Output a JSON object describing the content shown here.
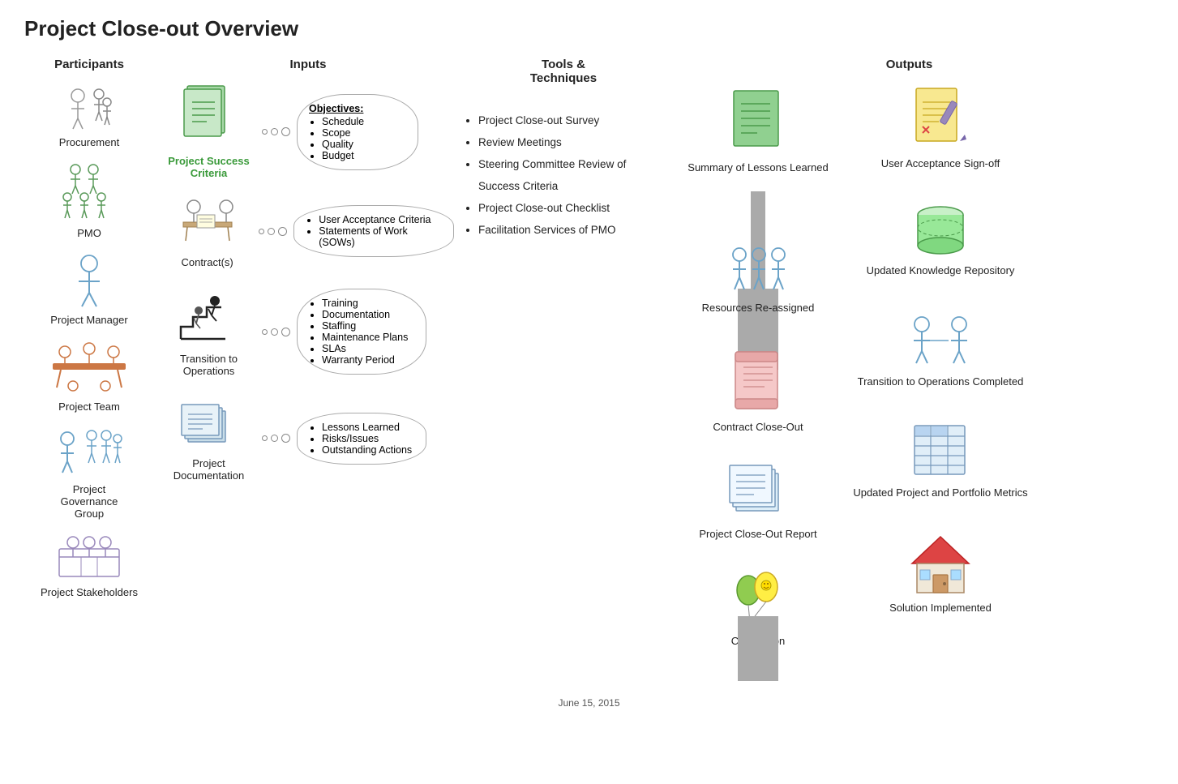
{
  "title": "Project Close-out Overview",
  "date": "June 15, 2015",
  "columns": {
    "participants": "Participants",
    "inputs": "Inputs",
    "tools": "Tools & Techniques",
    "outputs": "Outputs"
  },
  "participants": [
    {
      "label": "Procurement"
    },
    {
      "label": "PMO"
    },
    {
      "label": "Project Manager"
    },
    {
      "label": "Project Team"
    },
    {
      "label": "Project Governance Group"
    },
    {
      "label": "Project Stakeholders"
    }
  ],
  "inputs": [
    {
      "label": "Project Success Criteria",
      "thought": {
        "title": "Objectives:",
        "items": [
          "Schedule",
          "Scope",
          "Quality",
          "Budget"
        ]
      }
    },
    {
      "label": "Contract(s)",
      "thought": {
        "items": [
          "User Acceptance Criteria",
          "Statements of Work (SOWs)"
        ]
      }
    },
    {
      "label": "Transition to Operations",
      "thought": {
        "items": [
          "Training",
          "Documentation",
          "Staffing",
          "Maintenance Plans",
          "SLAs",
          "Warranty Period"
        ]
      }
    },
    {
      "label": "Project Documentation",
      "thought": {
        "items": [
          "Lessons Learned",
          "Risks/Issues",
          "Outstanding Actions"
        ]
      }
    }
  ],
  "tools": [
    "Project Close-out Survey",
    "Review Meetings",
    "Steering Committee Review of Success Criteria",
    "Project Close-out Checklist",
    "Facilitation Services of PMO"
  ],
  "outputs_main": [
    {
      "label": "Summary of Lessons Learned"
    },
    {
      "label": "Resources Re-assigned"
    },
    {
      "label": "Contract Close-Out"
    },
    {
      "label": "Project Close-Out Report"
    },
    {
      "label": "Celebration"
    }
  ],
  "outputs_right": [
    {
      "label": "User Acceptance Sign-off"
    },
    {
      "label": "Updated Knowledge Repository"
    },
    {
      "label": "Transition to Operations Completed"
    },
    {
      "label": "Updated Project and Portfolio Metrics"
    },
    {
      "label": "Solution Implemented"
    }
  ]
}
